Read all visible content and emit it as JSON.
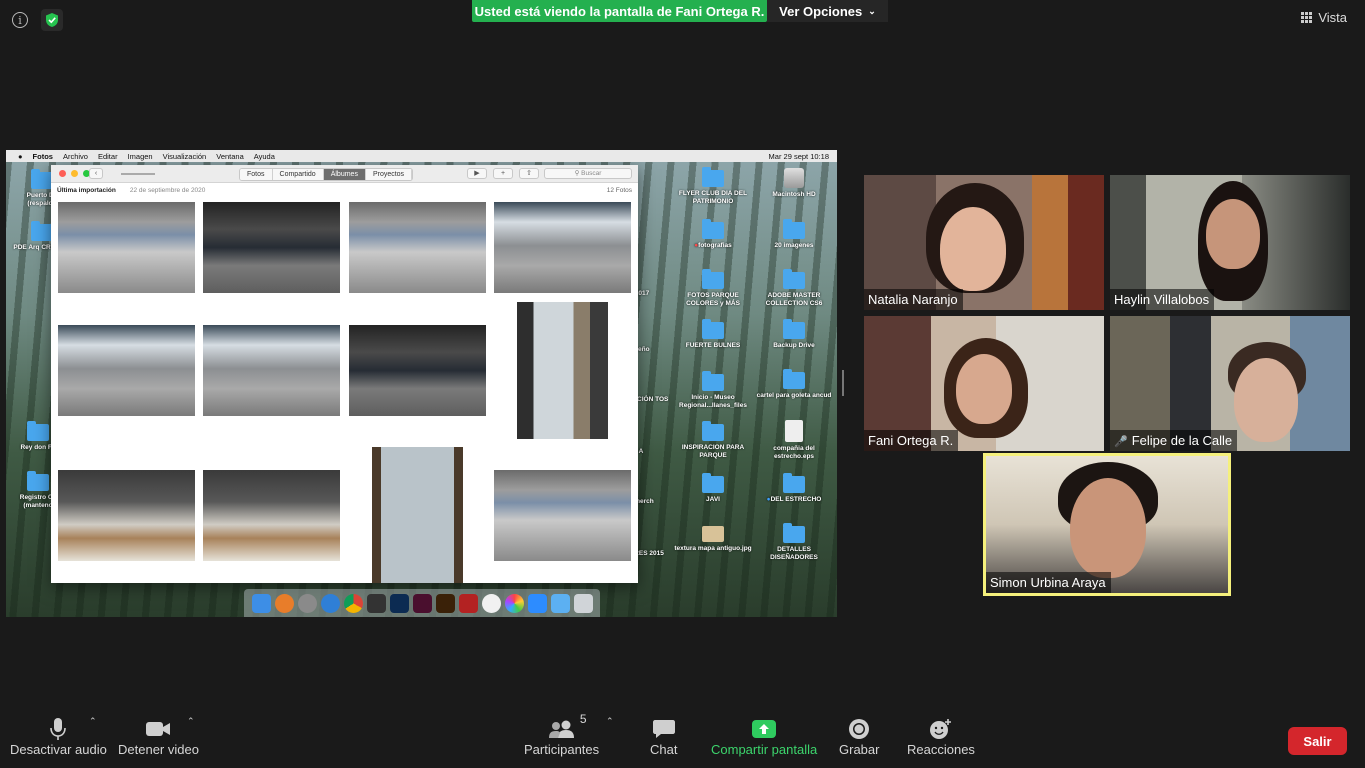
{
  "topbar": {
    "banner": "Usted está viendo la pantalla de Fani Ortega R.",
    "options": "Ver Opciones",
    "view": "Vista"
  },
  "shared_screen": {
    "menubar": {
      "app": "Fotos",
      "items": [
        "Archivo",
        "Editar",
        "Imagen",
        "Visualización",
        "Ventana",
        "Ayuda"
      ],
      "clock": "Mar 29 sept  10:18"
    },
    "photos": {
      "tabs": [
        "Fotos",
        "Compartido",
        "Álbumes",
        "Proyectos"
      ],
      "search_placeholder": "Buscar",
      "section_title": "Última importación",
      "section_date": "22 de septiembre de 2020",
      "count": "12 Fotos"
    },
    "desktop_left": [
      "Puerto De (respaldo",
      "PDE Arq CRDF dic",
      "Rey don Fe",
      "Registro Ca (manteno"
    ],
    "desktop_partial": [
      "2017",
      "seño",
      "BUCIÓN TOS",
      "A",
      "merch",
      "RES 2015"
    ],
    "desktop_col1": [
      "FLYER CLUB DIA DEL PATRIMONIO",
      "fotografias",
      "FOTOS PARQUE COLORES y MÁS",
      "FUERTE BULNES",
      "Inicio - Museo Regional...llanes_files",
      "INSPIRACION PARA PARQUE",
      "JAVI",
      "textura mapa antiguo.jpg"
    ],
    "desktop_col2": [
      "Macintosh HD",
      "20 imagenes",
      "ADOBE MASTER COLLECTION CS6",
      "Backup Drive",
      "cartel para goleta ancud",
      "compañia del estrecho.eps",
      "DEL ESTRECHO",
      "DETALLES DISEÑADORES"
    ]
  },
  "participants": [
    {
      "name": "Natalia Naranjo",
      "muted": false
    },
    {
      "name": "Haylin Villalobos",
      "muted": false
    },
    {
      "name": "Fani Ortega R.",
      "muted": false
    },
    {
      "name": "Felipe de la Calle",
      "muted": true
    },
    {
      "name": "Simon Urbina Araya",
      "muted": false,
      "active_speaker": true
    }
  ],
  "toolbar": {
    "mute": "Desactivar audio",
    "video": "Detener video",
    "participants": "Participantes",
    "participants_count": "5",
    "chat": "Chat",
    "share": "Compartir pantalla",
    "record": "Grabar",
    "reactions": "Reacciones",
    "leave": "Salir"
  },
  "colors": {
    "banner_green": "#24b04f",
    "share_green": "#3cd46c",
    "leave_red": "#d4262c",
    "active_speaker": "#f5f07c"
  }
}
